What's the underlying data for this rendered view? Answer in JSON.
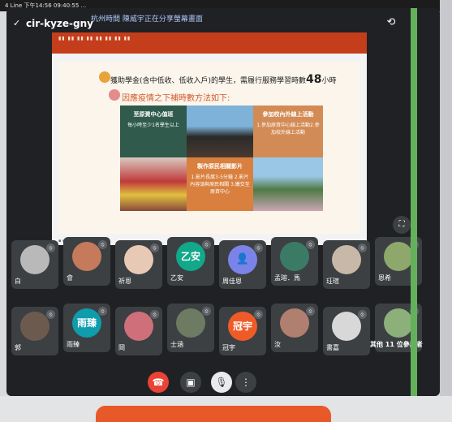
{
  "status_bar": {
    "text": "4 Line 下午14:56 09:40:55 ..."
  },
  "meeting": {
    "code": "cir-kyze-gny",
    "presenting_note": "杭州時間 陳威宇正在分享螢幕畫面",
    "header_icons": [
      "camera-switch-icon",
      "headphones-icon"
    ]
  },
  "slide": {
    "title_prefix": "獲助學金(含中低收、低收入戶)的學生，需履行服務學習時數",
    "title_number": "48",
    "title_suffix": "小時",
    "subtitle": "因應疫情之下補時數方法如下:",
    "tiles": [
      {
        "title": "至原資中心值班",
        "body": "每小時至少1名學生以上",
        "color": "#2f5a4c"
      },
      {
        "title": "參加校內外線上活動",
        "body": "1.參加原資中心線上活動2.參加校外線上活動",
        "color": "#d38b55"
      },
      {
        "title": "製作原民相關影片",
        "body": "1.影片長度3-5分鐘 2.影片內容須與原民相關 3.繳交至原資中心",
        "color": "#d9803f"
      }
    ]
  },
  "participants": [
    {
      "name": "白",
      "initials": "",
      "avatar_color": "#b9b9b9",
      "kind": "photo"
    },
    {
      "name": "會",
      "initials": "",
      "avatar_color": "#c67a5c",
      "kind": "photo"
    },
    {
      "name": "祈恩",
      "initials": "",
      "avatar_color": "#e7c9b5",
      "kind": "photo"
    },
    {
      "name": "乙安",
      "initials": "乙安",
      "avatar_color": "#12a88a",
      "kind": "letter"
    },
    {
      "name": "周佳恩",
      "initials": "",
      "avatar_color": "#7c83e8",
      "kind": "default"
    },
    {
      "name": "孟瑢．馬",
      "initials": "",
      "avatar_color": "#3b7b66",
      "kind": "photo"
    },
    {
      "name": "玨瑄",
      "initials": "",
      "avatar_color": "#c8b8a8",
      "kind": "photo"
    },
    {
      "name": "恩希",
      "initials": "",
      "avatar_color": "#8ea86b",
      "kind": "photo"
    },
    {
      "name": "郭",
      "initials": "",
      "avatar_color": "#6d5a4f",
      "kind": "photo"
    },
    {
      "name": "雨臻",
      "initials": "雨臻",
      "avatar_color": "#0f9cac",
      "kind": "letter"
    },
    {
      "name": "岡",
      "initials": "",
      "avatar_color": "#cf6f7a",
      "kind": "photo"
    },
    {
      "name": "士涵",
      "initials": "",
      "avatar_color": "#6d7b63",
      "kind": "photo"
    },
    {
      "name": "冠宇",
      "initials": "冠宇",
      "avatar_color": "#ef5b27",
      "kind": "letter"
    },
    {
      "name": "汝",
      "initials": "",
      "avatar_color": "#b07f70",
      "kind": "photo"
    },
    {
      "name": "書嘉",
      "initials": "",
      "avatar_color": "#d8d8d8",
      "kind": "photo"
    },
    {
      "name": "其他 11 位參與者",
      "initials": "",
      "avatar_color": "#8db07a",
      "kind": "photo"
    }
  ],
  "controls": [
    {
      "name": "end-call-button",
      "icon": "phone-hangup-icon",
      "glyph": "☎",
      "color": "#ea4335"
    },
    {
      "name": "camera-toggle-button",
      "icon": "camera-icon",
      "glyph": "▣",
      "color": "#3c4043"
    },
    {
      "name": "mic-toggle-button",
      "icon": "mic-off-icon",
      "glyph": "🎙",
      "color": "#e8eaed"
    },
    {
      "name": "more-options-button",
      "icon": "more-vert-icon",
      "glyph": "⋮",
      "color": "#3c4043"
    }
  ]
}
